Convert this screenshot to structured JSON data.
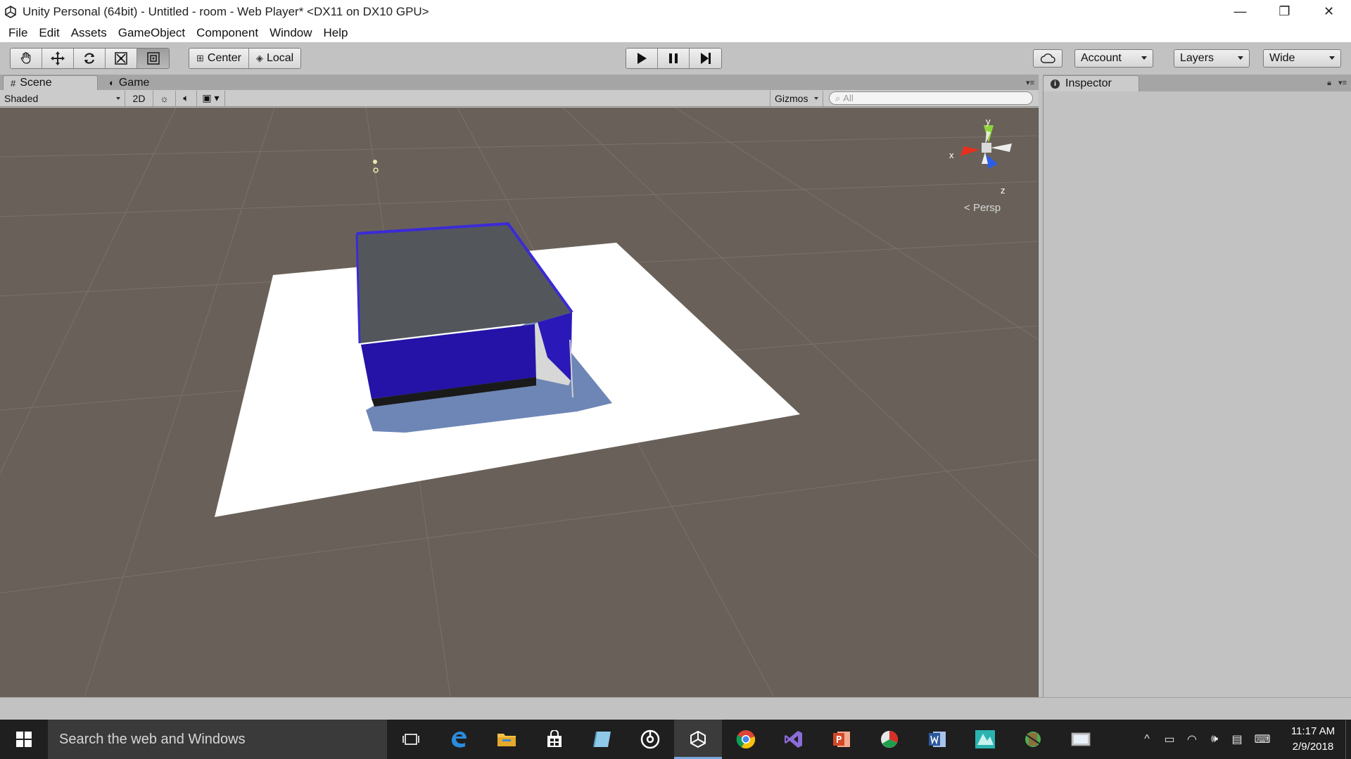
{
  "window": {
    "title": "Unity Personal (64bit) - Untitled - room - Web Player* <DX11 on DX10 GPU>",
    "minimize_glyph": "—",
    "restore_glyph": "❐",
    "close_glyph": "✕"
  },
  "menu": [
    "File",
    "Edit",
    "Assets",
    "GameObject",
    "Component",
    "Window",
    "Help"
  ],
  "toolbar": {
    "pivot_label": "Center",
    "space_label": "Local",
    "account_label": "Account",
    "layers_label": "Layers",
    "layout_label": "Wide"
  },
  "tabs": {
    "scene": "Scene",
    "game": "Game",
    "inspector": "Inspector"
  },
  "scene_toolbar": {
    "shading_mode": "Shaded",
    "mode_2d": "2D",
    "gizmos_label": "Gizmos",
    "search_placeholder": "All"
  },
  "gizmo": {
    "y_label": "y",
    "x_label": "x",
    "z_label": "z",
    "projection_label": "Persp",
    "y_color": "#8fd43a",
    "x_color": "#e8301c",
    "z_color": "#2a5de8"
  },
  "scene": {
    "sky_color": "#696159",
    "plane_color": "#ffffff",
    "box_top_color": "#53575c",
    "box_side_color": "#2413a6",
    "shadow_color": "#6e86b6"
  },
  "taskbar": {
    "search_placeholder": "Search the web and Windows",
    "time": "11:17 AM",
    "date": "2/9/2018",
    "apps": [
      "task-view",
      "edge",
      "file-explorer",
      "store",
      "app-blue",
      "groove",
      "unity",
      "chrome",
      "visual-studio",
      "powerpoint",
      "app-green-red",
      "word",
      "app-teal",
      "app-green",
      "app-grey"
    ]
  }
}
